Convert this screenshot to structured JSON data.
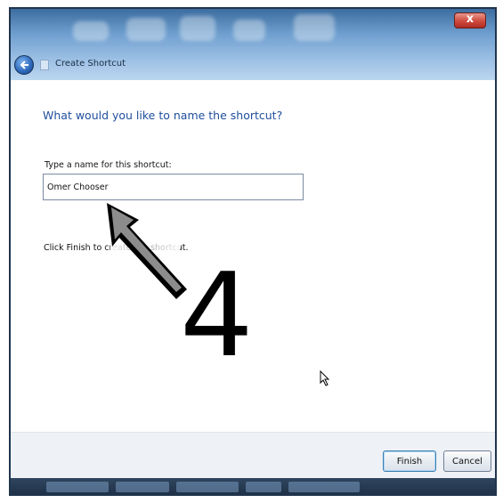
{
  "window": {
    "title": "Create Shortcut",
    "close_symbol": "x"
  },
  "wizard": {
    "heading": "What would you like to name the shortcut?",
    "name_label": "Type a name for this shortcut:",
    "name_value": "Omer Chooser",
    "hint": "Click Finish to create the shortcut."
  },
  "annotation": {
    "step_number": "4"
  },
  "buttons": {
    "finish": "Finish",
    "cancel": "Cancel"
  },
  "colors": {
    "heading": "#1f4e9c",
    "close_button": "#cf4a3e",
    "title_glass": "#6f9fcf",
    "footer": "#eef1f5"
  },
  "icons": [
    "back-arrow-icon",
    "shortcut-icon",
    "close-icon",
    "mouse-cursor-icon",
    "annotation-arrow-icon"
  ]
}
